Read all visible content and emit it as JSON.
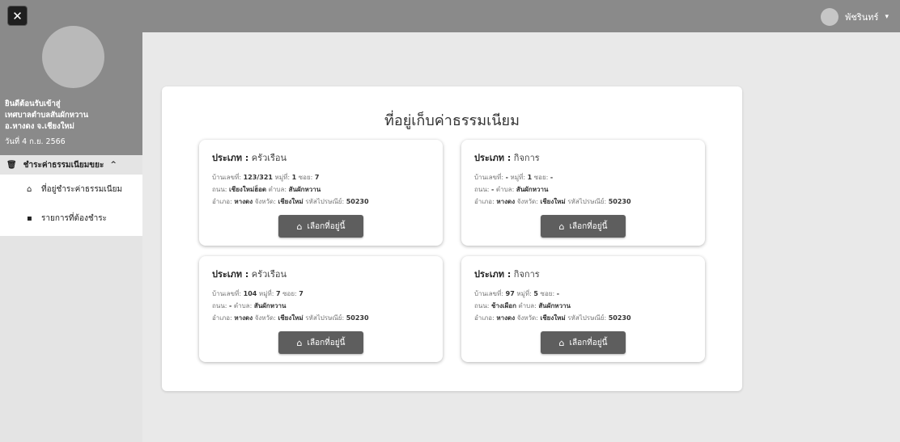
{
  "topbar": {
    "user_name": "พัชรินทร์",
    "caret": "▾"
  },
  "sidebar": {
    "close_glyph": "✕",
    "welcome_lines": [
      "ยินดีต้อนรับเข้าสู่",
      "เทศบาลตำบลสันผักหวาน",
      "อ.หางดง จ.เชียงใหม่"
    ],
    "date": "วันที่ 4 ก.ย. 2566",
    "group_label": "ชำระค่าธรรมเนียมขยะ",
    "group_icon": "trash-icon",
    "group_caret": "^",
    "items": [
      {
        "label": "ที่อยู่ชำระค่าธรรมเนียม",
        "icon": "home-icon"
      },
      {
        "label": "รายการที่ต้องชำระ",
        "icon": "list-icon"
      }
    ]
  },
  "main": {
    "title": "ที่อยู่เก็บค่าธรรมเนียม",
    "labels": {
      "type": "ประเภท :",
      "house_no": "บ้านเลขที่:",
      "moo": "หมู่ที่:",
      "soi": "ซอย:",
      "road": "ถนน:",
      "subdistrict": "ตำบล:",
      "district": "อำเภอ:",
      "province": "จังหวัด:",
      "postcode": "รหัสไปรษณีย์:"
    },
    "select_label": "เลือกที่อยู่นี้",
    "addresses": [
      {
        "type": "ครัวเรือน",
        "house_no": "123/321",
        "moo": "1",
        "soi": "7",
        "road": "เชียงใหม่ฮ็อด",
        "subdistrict": "สันผักหวาน",
        "district": "หางดง",
        "province": "เชียงใหม่",
        "postcode": "50230"
      },
      {
        "type": "กิจการ",
        "house_no": "-",
        "moo": "1",
        "soi": "-",
        "road": "-",
        "subdistrict": "สันผักหวาน",
        "district": "หางดง",
        "province": "เชียงใหม่",
        "postcode": "50230"
      },
      {
        "type": "ครัวเรือน",
        "house_no": "104",
        "moo": "7",
        "soi": "7",
        "road": "-",
        "subdistrict": "สันผักหวาน",
        "district": "หางดง",
        "province": "เชียงใหม่",
        "postcode": "50230"
      },
      {
        "type": "กิจการ",
        "house_no": "97",
        "moo": "5",
        "soi": "-",
        "road": "ช้างเผือก",
        "subdistrict": "สันผักหวาน",
        "district": "หางดง",
        "province": "เชียงใหม่",
        "postcode": "50230"
      }
    ]
  }
}
